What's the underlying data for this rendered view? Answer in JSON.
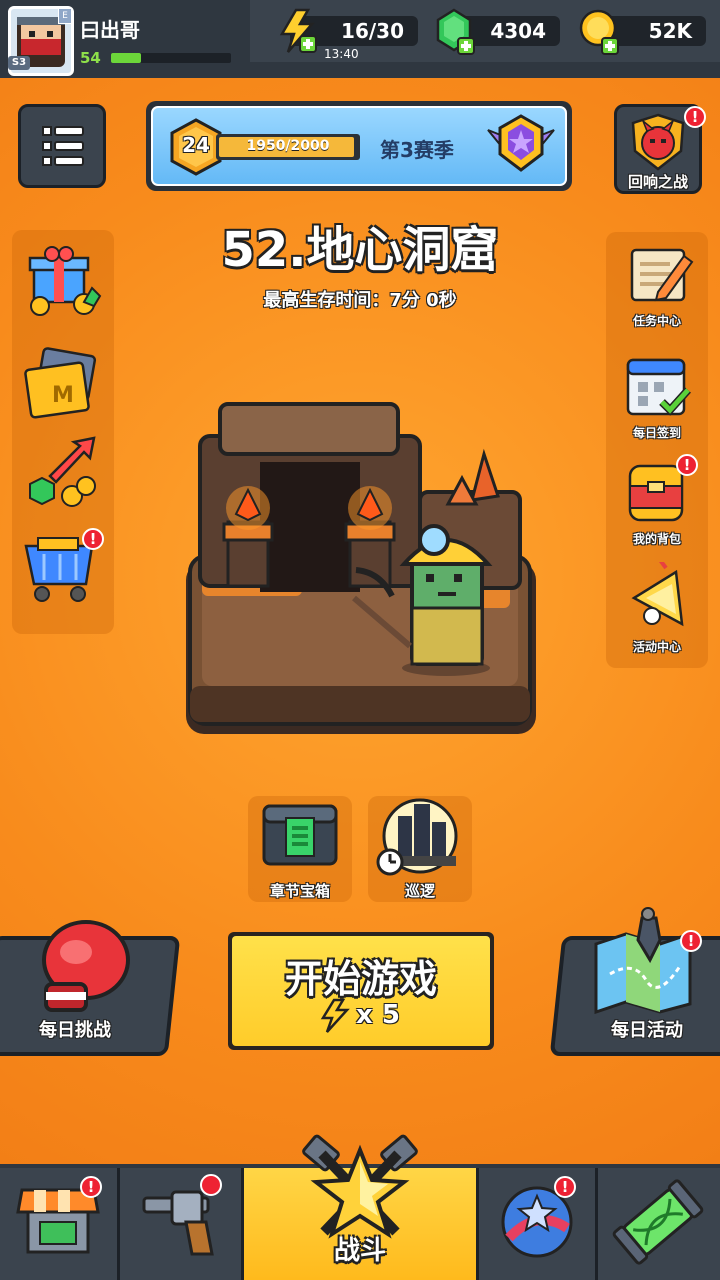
{
  "player": {
    "name": "曰出哥",
    "level": "54",
    "rank_tag": "S3"
  },
  "resources": {
    "energy": "16/30",
    "energy_timer": "13:40",
    "gems": "4304",
    "coins": "52K"
  },
  "season": {
    "level": "24",
    "progress_text": "1950/2000",
    "progress": 0.975,
    "label": "第3赛季"
  },
  "echo_battle": {
    "label": "回响之战",
    "badge": "!"
  },
  "chapter": {
    "title": "52.地心洞窟",
    "best_time": "最高生存时间：7分 0秒"
  },
  "right_menu": [
    {
      "label": "任务中心",
      "icon": "quest-scroll-icon"
    },
    {
      "label": "每日签到",
      "icon": "calendar-icon"
    },
    {
      "label": "我的背包",
      "icon": "backpack-icon"
    },
    {
      "label": "活动中心",
      "icon": "event-horn-icon"
    }
  ],
  "mid_buttons": {
    "chest": "章节宝箱",
    "patrol": "巡逻"
  },
  "daily_challenge": "每日挑战",
  "start": {
    "label": "开始游戏",
    "cost": "x 5"
  },
  "daily_event": "每日活动",
  "bottom_nav": {
    "battle": "战斗"
  },
  "colors": {
    "accent_orange": "#f88b1c",
    "dark_panel": "#2f3740",
    "start_yellow": "#ffd93a",
    "badge_red": "#ee2233"
  }
}
